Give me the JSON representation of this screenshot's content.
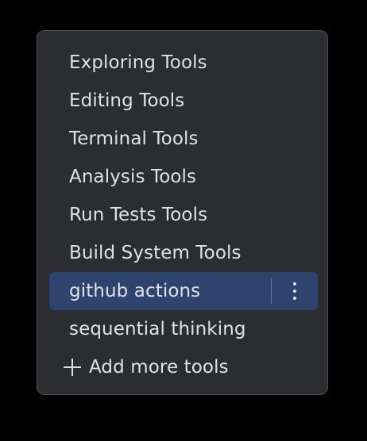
{
  "menu": {
    "items": [
      {
        "label": "Exploring Tools"
      },
      {
        "label": "Editing Tools"
      },
      {
        "label": "Terminal Tools"
      },
      {
        "label": "Analysis Tools"
      },
      {
        "label": "Run Tests Tools"
      },
      {
        "label": "Build System Tools"
      },
      {
        "label": "github actions",
        "selected": true
      },
      {
        "label": "sequential thinking"
      }
    ],
    "add_more_label": "Add more tools",
    "more_options_icon": "more-vertical-icon",
    "add_icon": "plus-icon"
  },
  "colors": {
    "background": "#000000",
    "popup_background": "#2b2d30",
    "popup_border": "#4e5157",
    "selected_row": "#2e436e",
    "text": "#dfe1e5"
  }
}
